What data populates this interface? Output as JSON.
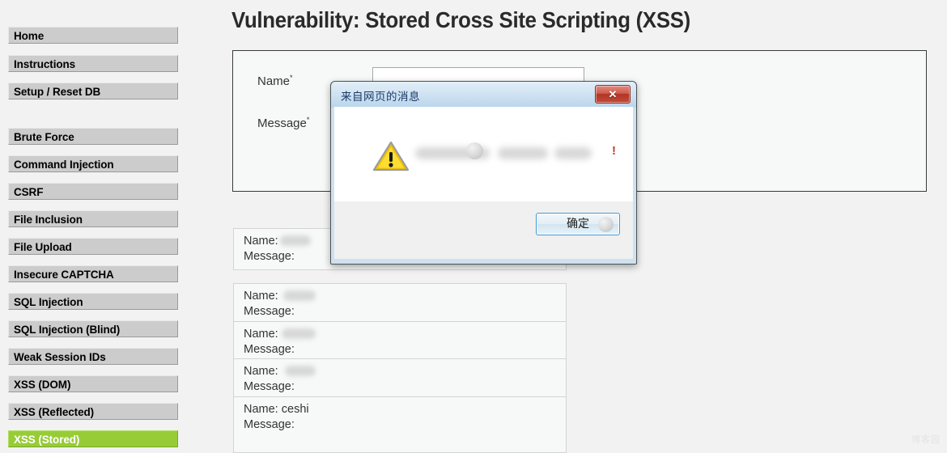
{
  "page": {
    "title": "Vulnerability: Stored Cross Site Scripting (XSS)",
    "background_color": "#f2f2f2",
    "watermark": "博客园"
  },
  "sidebar": {
    "active_color": "#97cc36",
    "item_color": "#cccccc",
    "groups": [
      {
        "items": [
          {
            "label": "Home",
            "active": false
          },
          {
            "label": "Instructions",
            "active": false
          },
          {
            "label": "Setup / Reset DB",
            "active": false
          }
        ]
      },
      {
        "items": [
          {
            "label": "Brute Force",
            "active": false
          },
          {
            "label": "Command Injection",
            "active": false
          },
          {
            "label": "CSRF",
            "active": false
          },
          {
            "label": "File Inclusion",
            "active": false
          },
          {
            "label": "File Upload",
            "active": false
          },
          {
            "label": "Insecure CAPTCHA",
            "active": false
          },
          {
            "label": "SQL Injection",
            "active": false
          },
          {
            "label": "SQL Injection (Blind)",
            "active": false
          },
          {
            "label": "Weak Session IDs",
            "active": false
          },
          {
            "label": "XSS (DOM)",
            "active": false
          },
          {
            "label": "XSS (Reflected)",
            "active": false
          },
          {
            "label": "XSS (Stored)",
            "active": true
          }
        ]
      }
    ]
  },
  "form": {
    "name_label": "Name",
    "name_required_mark": "*",
    "name_value": "",
    "message_label": "Message",
    "message_required_mark": "*",
    "message_value": ""
  },
  "guestbook": {
    "name_prefix": "Name:",
    "message_prefix": "Message:",
    "entries": [
      {
        "name": "",
        "name_redacted": true,
        "redact_width": 46,
        "message": ""
      },
      {
        "name": "",
        "name_redacted": true,
        "redact_width": 44,
        "message": ""
      },
      {
        "name": "",
        "name_redacted": true,
        "redact_width": 46,
        "message": ""
      },
      {
        "name": "",
        "name_redacted": true,
        "redact_width": 42,
        "message": ""
      },
      {
        "name": "ceshi",
        "name_redacted": false,
        "redact_width": 0,
        "message": ""
      }
    ]
  },
  "dialog": {
    "title": "来自网页的消息",
    "icon": "warning-triangle-icon",
    "message_text": "",
    "message_redacted": true,
    "message_trailing": "!",
    "ok_label": "确定",
    "close_label": "✕",
    "close_button_color": "#b03526",
    "accent_color": "#3c9ad6"
  }
}
